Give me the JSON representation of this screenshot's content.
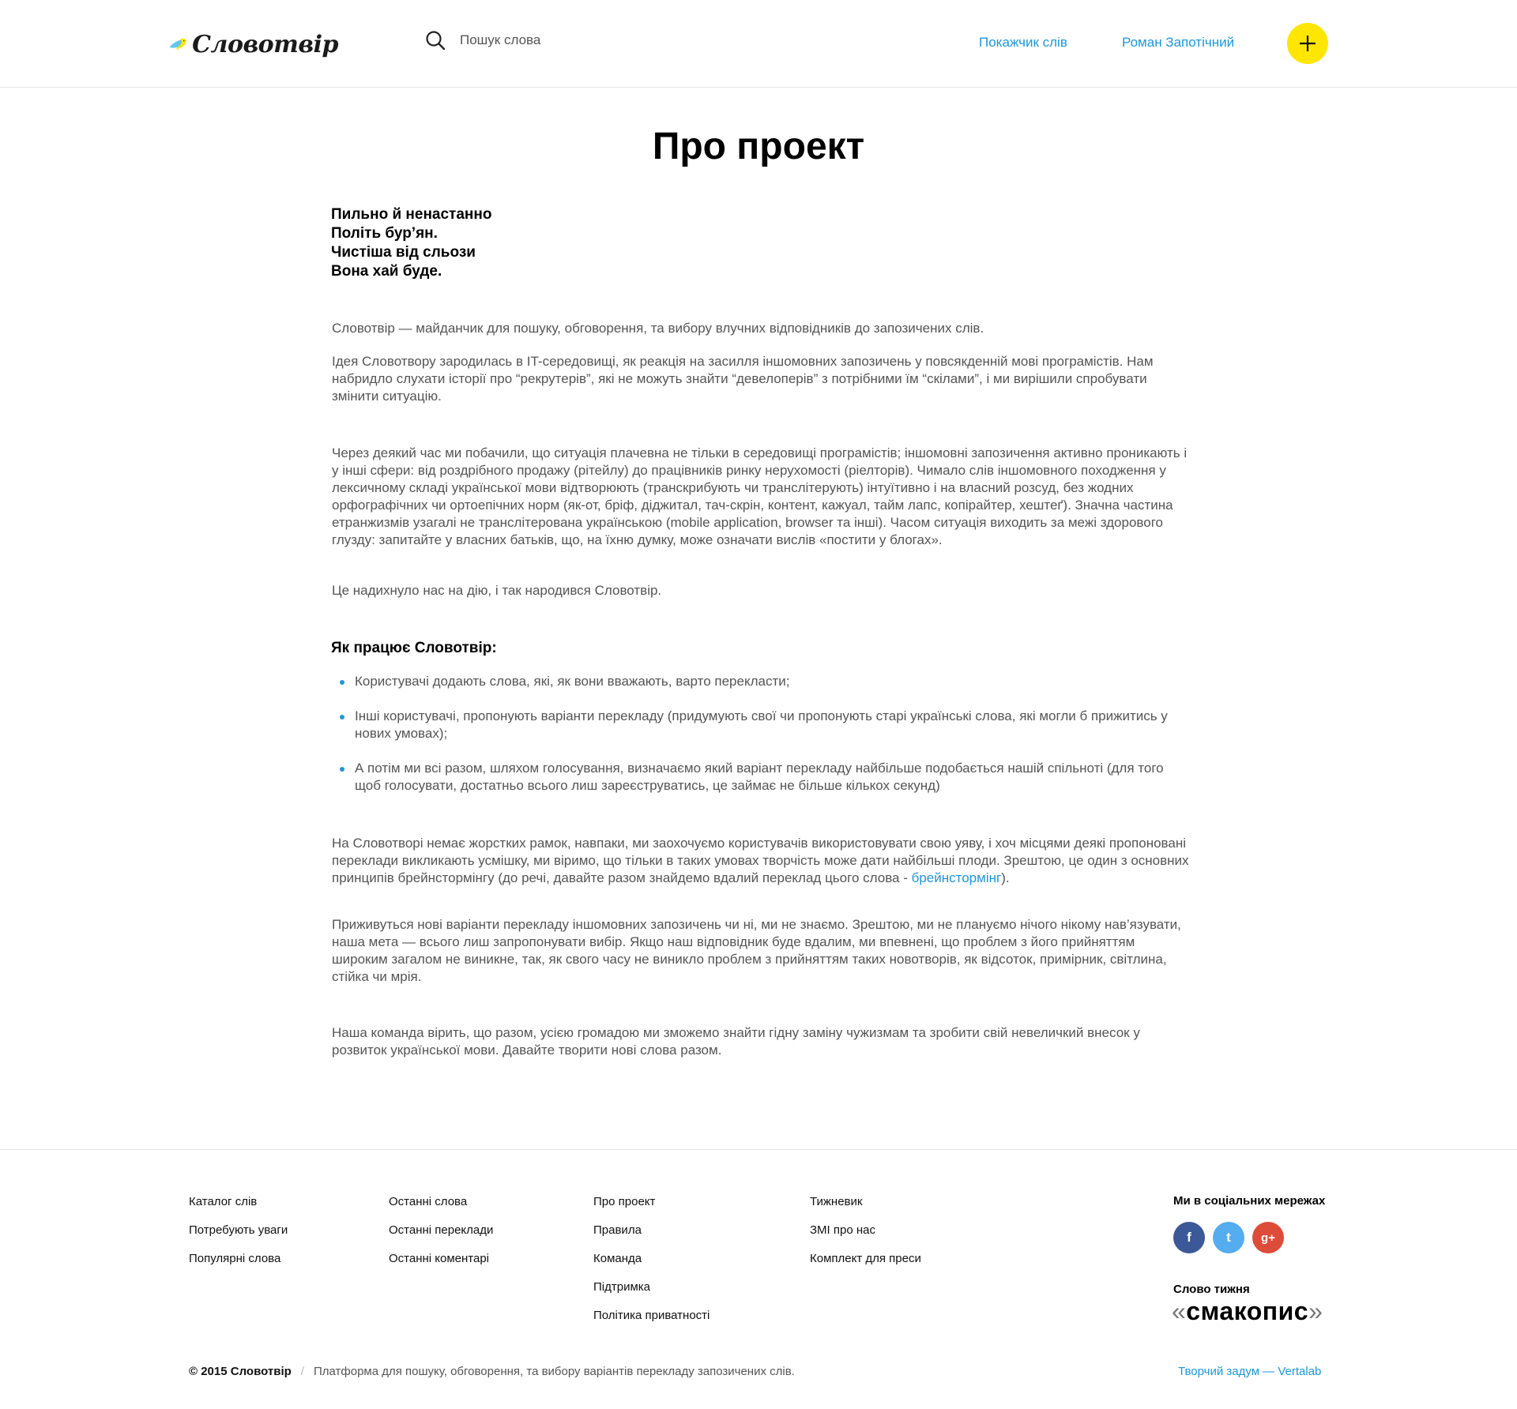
{
  "header": {
    "logo_text": "Словотвір",
    "search_placeholder": "Пошук слова",
    "nav": {
      "index_link": "Покажчик слів",
      "user_link": "Роман Запотічний"
    },
    "add_button_icon": "plus-icon",
    "colors": {
      "accent": "#1d97d9",
      "add_button": "#ffe600"
    }
  },
  "main": {
    "title": "Про проект",
    "poem": [
      "Пильно й ненастанно",
      "Політь бур’ян.",
      "Чистіша від сльози",
      "Вона хай буде."
    ],
    "paragraphs": [
      "Словотвір — майданчик для пошуку, обговорення, та вибору влучних відповідників до запозичених слів.",
      "Ідея Словотвору зародилась в IT-середовищі, як реакція на засилля іншомовних запозичень у повсякденній мові програмістів. Нам набридло слухати історії про “рекрутерів”, які не можуть знайти “девелоперів” з потрібними їм “скілами”, і ми вирішили спробувати змінити ситуацію.",
      "Через деякий час ми побачили, що ситуація плачевна не тільки в середовищі програмістів; іншомовні запозичення активно проникають і у інші сфери: від роздрібного продажу (рітейлу) до працівників ринку нерухомості (ріелторів). Чимало слів іншомовного походження у лексичному складі української мови відтворюють (транскрибують чи транслітерують) інтуїтивно і на власний розсуд, без жодних орфографічних чи ортоепічних норм (як-от, бріф, діджитал, тач-скрін, контент, кажуал, тайм лапс, копірайтер, хештеґ). Значна частина етранжизмів узагалі не транслітерована українською (mobile application, browser та інші). Часом ситуація виходить за межі здорового глузду: запитайте у власних батьків, що, на їхню думку, може означати вислів «постити у блогах».",
      "Це надихнуло нас на дію, і так народився Словотвір."
    ],
    "how_title": "Як працює Словотвір:",
    "how_items": [
      "Користувачі додають слова, які, як вони вважають, варто перекласти;",
      "Інші користувачі, пропонують варіанти перекладу (придумують свої чи пропонують старі українські слова, які могли б прижитись у нових умовах);",
      "А потім ми всі разом, шляхом голосування, визначаємо який варіант перекладу найбільше подобається нашій спільноті (для того щоб голосувати, достатньо всього лиш зареєструватись, це займає не більше кількох секунд)"
    ],
    "freedom_text": "На Словотворі немає жорстких рамок, навпаки, ми заохочуємо користувачів використовувати свою уяву, і хоч місцями деякі пропоновані переклади викликають усмішку, ми віримо, що тільки в таких умовах творчість може дати найбільші плоди. Зрештою, це один з основних принципів брейнстормінгу (до речі, давайте разом знайдемо вдалий переклад цього слова - ",
    "freedom_link": "брейнстормінг",
    "freedom_end": ").",
    "future_text": "Приживуться нові варіанти перекладу іншомовних запозичень чи ні, ми не знаємо. Зрештою, ми не плануємо нічого нікому нав’язувати, наша мета — всього лиш запропонувати вибір. Якщо наш відповідник буде вдалим, ми впевнені, що проблем з його прийняттям широким загалом не виникне, так, як свого часу не виникло проблем з прийняттям таких новотворів, як відсоток, примірник, світлина, стійка чи мрія.",
    "team_text": "Наша команда вірить, що разом, усією громадою ми зможемо знайти гідну заміну чужизмам та зробити свій невеличкий внесок у розвиток української мови. Давайте творити нові слова разом."
  },
  "footer": {
    "col1": [
      "Каталог слів",
      "Потребують уваги",
      "Популярні слова"
    ],
    "col2": [
      "Останні слова",
      "Останні переклади",
      "Останні коментарі"
    ],
    "col3": [
      "Про проект",
      "Правила",
      "Команда",
      "Підтримка",
      "Політика приватності"
    ],
    "col4": [
      "Тижневик",
      "ЗМІ про нас",
      "Комплект для преси"
    ],
    "social_title": "Ми в соціальних мережах",
    "social": [
      {
        "icon": "facebook-icon",
        "glyph": "f",
        "color": "#3b5998"
      },
      {
        "icon": "twitter-icon",
        "glyph": "t",
        "color": "#55acee"
      },
      {
        "icon": "google-plus-icon",
        "glyph": "g+",
        "color": "#dd4b39"
      }
    ],
    "word_title": "Слово тижня",
    "word": "смакопис",
    "quote_open": "«",
    "quote_close": "»",
    "copyright": "© 2015 Словотвір",
    "separator": "/",
    "description": "Платформа для пошуку, обговорення, та вибору варіантів перекладу запозичених слів.",
    "credit": "Творчий задум — Vertalab"
  }
}
